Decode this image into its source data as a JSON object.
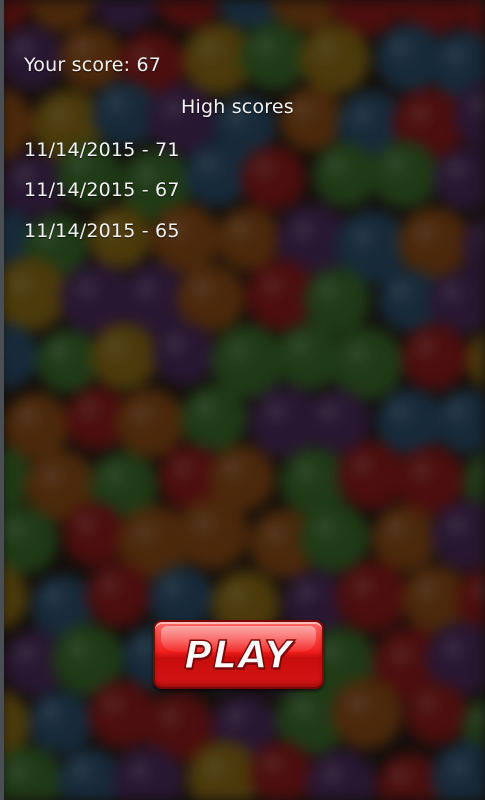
{
  "score": {
    "label": "Your score: 67"
  },
  "high_scores": {
    "title": "High scores",
    "entries": [
      "11/14/2015 - 71",
      "11/14/2015 - 67",
      "11/14/2015 - 65"
    ]
  },
  "play_button": {
    "label": "PLAY",
    "color": "#e8201c"
  },
  "background": {
    "description_colors": [
      "#3a6b2a",
      "#8a1a1a",
      "#2a4e6b",
      "#8a6a14",
      "#4a2a5a",
      "#8a4a14"
    ]
  }
}
